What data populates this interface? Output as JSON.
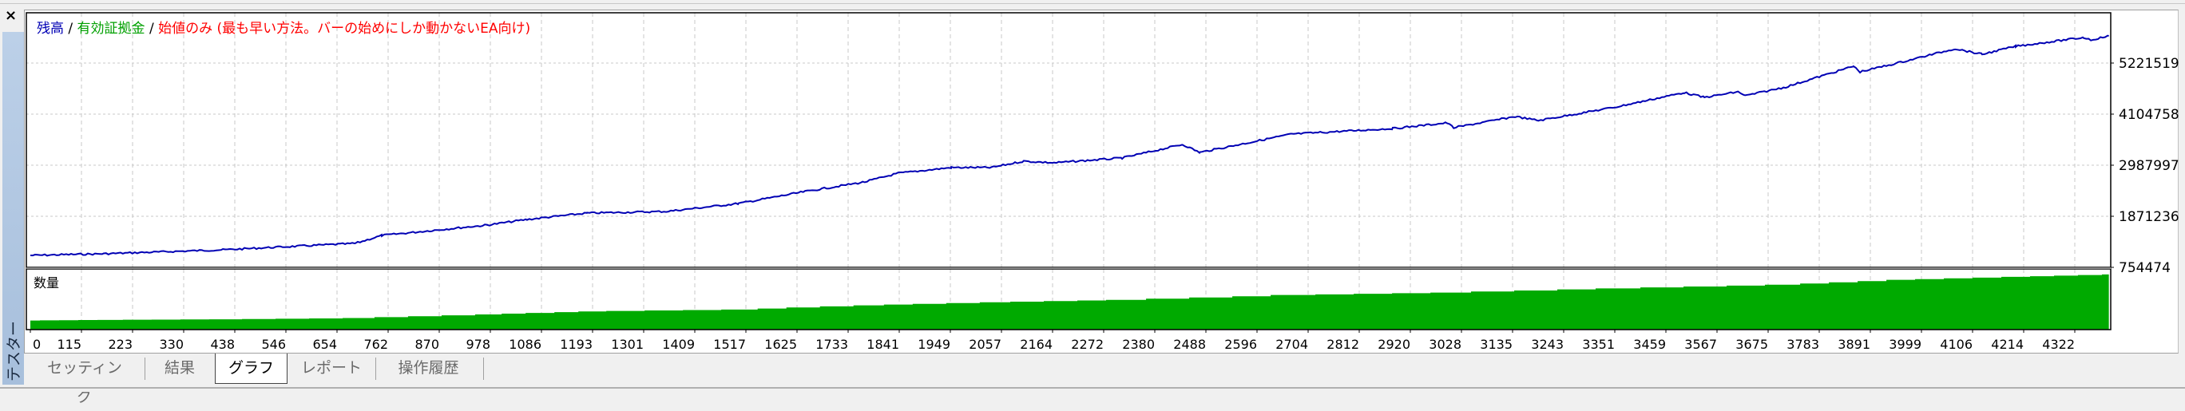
{
  "window": {
    "close_label": "×",
    "side_tab": "テスター"
  },
  "title": {
    "balance": "残高",
    "sep1": " / ",
    "equity": "有効証拠金",
    "sep2": " / ",
    "model": "始値のみ (最も早い方法。バーの始めにしか動かないEA向け)"
  },
  "volume_label": "数量",
  "tabs": [
    {
      "label": "セッティング",
      "active": false
    },
    {
      "label": "結果",
      "active": false
    },
    {
      "label": "グラフ",
      "active": true
    },
    {
      "label": "レポート",
      "active": false
    },
    {
      "label": "操作履歴",
      "active": false
    }
  ],
  "colors": {
    "balance": "#0000b4",
    "equity": "#00a000",
    "model": "#ff0000",
    "volume": "#00aa00",
    "grid": "#c8c8c8"
  },
  "chart_data": {
    "type": "line",
    "title": "残高 / 有効証拠金 / 始値のみ (最も早い方法。バーの始めにしか動かないEA向け)",
    "xlabel": "",
    "ylabel": "",
    "xlim": [
      0,
      4398
    ],
    "ylim": [
      754474,
      6321000
    ],
    "grid": true,
    "x_ticks": [
      "0",
      "115",
      "223",
      "330",
      "438",
      "546",
      "654",
      "762",
      "870",
      "978",
      "1086",
      "1193",
      "1301",
      "1409",
      "1517",
      "1625",
      "1733",
      "1841",
      "1949",
      "2057",
      "2164",
      "2272",
      "2380",
      "2488",
      "2596",
      "2704",
      "2812",
      "2920",
      "3028",
      "3135",
      "3243",
      "3351",
      "3459",
      "3567",
      "3675",
      "3783",
      "3891",
      "3999",
      "4106",
      "4214",
      "4322"
    ],
    "y_ticks": [
      "5221519",
      "4104758",
      "2987997",
      "1871236",
      "754474"
    ],
    "y_tick_values": [
      5221519,
      4104758,
      2987997,
      1871236,
      754474
    ],
    "series": [
      {
        "name": "残高",
        "x": [
          0,
          155,
          407,
          687,
          743,
          966,
          1050,
          1177,
          1344,
          1497,
          1638,
          1764,
          1835,
          1947,
          2031,
          2100,
          2164,
          2308,
          2436,
          2472,
          2666,
          2880,
          2995,
          3009,
          3139,
          3188,
          3353,
          3496,
          3539,
          3611,
          3625,
          3711,
          3854,
          3868,
          3954,
          4069,
          4126,
          4197,
          4341,
          4356,
          4394
        ],
        "y": [
          1016000,
          1051000,
          1138000,
          1278000,
          1452000,
          1679000,
          1801000,
          1941000,
          1976000,
          2150000,
          2412000,
          2622000,
          2813000,
          2936000,
          2936000,
          3075000,
          3040000,
          3145000,
          3442000,
          3267000,
          3668000,
          3790000,
          3913000,
          3808000,
          4052000,
          3965000,
          4262000,
          4576000,
          4471000,
          4593000,
          4506000,
          4698000,
          5152000,
          5029000,
          5239000,
          5535000,
          5413000,
          5588000,
          5780000,
          5727000,
          5815000
        ]
      }
    ],
    "volume": {
      "name": "数量",
      "x": [
        0,
        155,
        407,
        687,
        966,
        1177,
        1497,
        1764,
        2031,
        2308,
        2666,
        2995,
        3353,
        3711,
        3954,
        4197,
        4394
      ],
      "relative_level": [
        0.15,
        0.16,
        0.17,
        0.19,
        0.25,
        0.3,
        0.33,
        0.4,
        0.45,
        0.49,
        0.57,
        0.61,
        0.68,
        0.74,
        0.82,
        0.87,
        0.91
      ]
    }
  }
}
